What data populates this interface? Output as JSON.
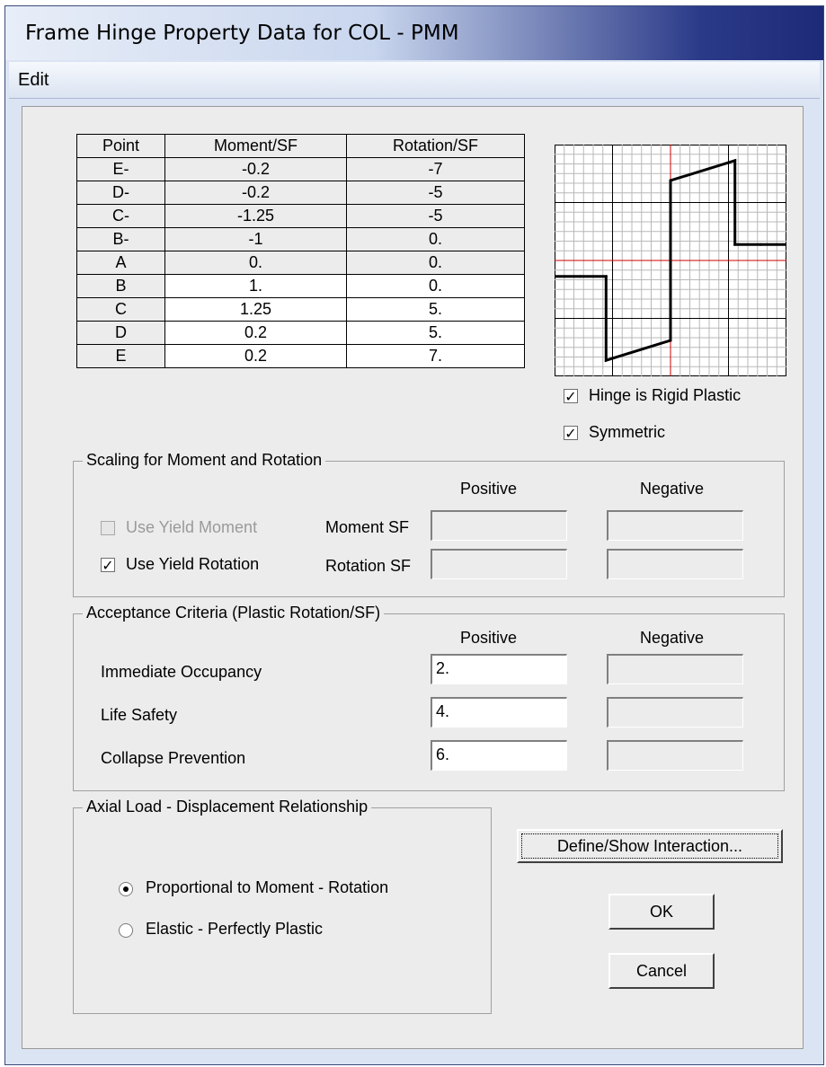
{
  "window": {
    "title": "Frame Hinge Property Data for COL - PMM"
  },
  "menu": {
    "edit": "Edit"
  },
  "table": {
    "headers": [
      "Point",
      "Moment/SF",
      "Rotation/SF"
    ],
    "rows": [
      [
        "E-",
        "-0.2",
        "-7"
      ],
      [
        "D-",
        "-0.2",
        "-5"
      ],
      [
        "C-",
        "-1.25",
        "-5"
      ],
      [
        "B-",
        "-1",
        "0."
      ],
      [
        "A",
        "0.",
        "0."
      ],
      [
        "B",
        "1.",
        "0."
      ],
      [
        "C",
        "1.25",
        "5."
      ],
      [
        "D",
        "0.2",
        "5."
      ],
      [
        "E",
        "0.2",
        "7."
      ]
    ]
  },
  "chart_data": {
    "type": "line",
    "series": [
      {
        "x": [
          -7,
          -5,
          -5,
          0,
          0,
          0,
          5,
          5,
          7
        ],
        "y": [
          -0.2,
          -0.2,
          -1.25,
          -1,
          0,
          1,
          1.25,
          0.2,
          0.2
        ]
      }
    ],
    "grid": true
  },
  "options": {
    "rigid_plastic": {
      "label": "Hinge is Rigid Plastic",
      "checked": true
    },
    "symmetric": {
      "label": "Symmetric",
      "checked": true
    }
  },
  "scaling": {
    "title": "Scaling for Moment and Rotation",
    "positive_header": "Positive",
    "negative_header": "Negative",
    "use_yield_moment": {
      "label": "Use Yield Moment",
      "checked": false,
      "enabled": false
    },
    "use_yield_rotation": {
      "label": "Use Yield Rotation",
      "checked": true
    },
    "moment_sf_label": "Moment SF",
    "rotation_sf_label": "Rotation SF",
    "moment_sf_pos": "",
    "moment_sf_neg": "",
    "rotation_sf_pos": "",
    "rotation_sf_neg": ""
  },
  "acceptance": {
    "title": "Acceptance Criteria (Plastic Rotation/SF)",
    "positive_header": "Positive",
    "negative_header": "Negative",
    "rows": [
      {
        "label": "Immediate Occupancy",
        "positive": "2.",
        "negative": ""
      },
      {
        "label": "Life Safety",
        "positive": "4.",
        "negative": ""
      },
      {
        "label": "Collapse Prevention",
        "positive": "6.",
        "negative": ""
      }
    ]
  },
  "axial": {
    "title": "Axial Load - Displacement Relationship",
    "proportional": {
      "label": "Proportional to Moment - Rotation",
      "selected": true
    },
    "elastic": {
      "label": "Elastic - Perfectly Plastic",
      "selected": false
    }
  },
  "buttons": {
    "define_show": "Define/Show Interaction...",
    "ok": "OK",
    "cancel": "Cancel"
  }
}
